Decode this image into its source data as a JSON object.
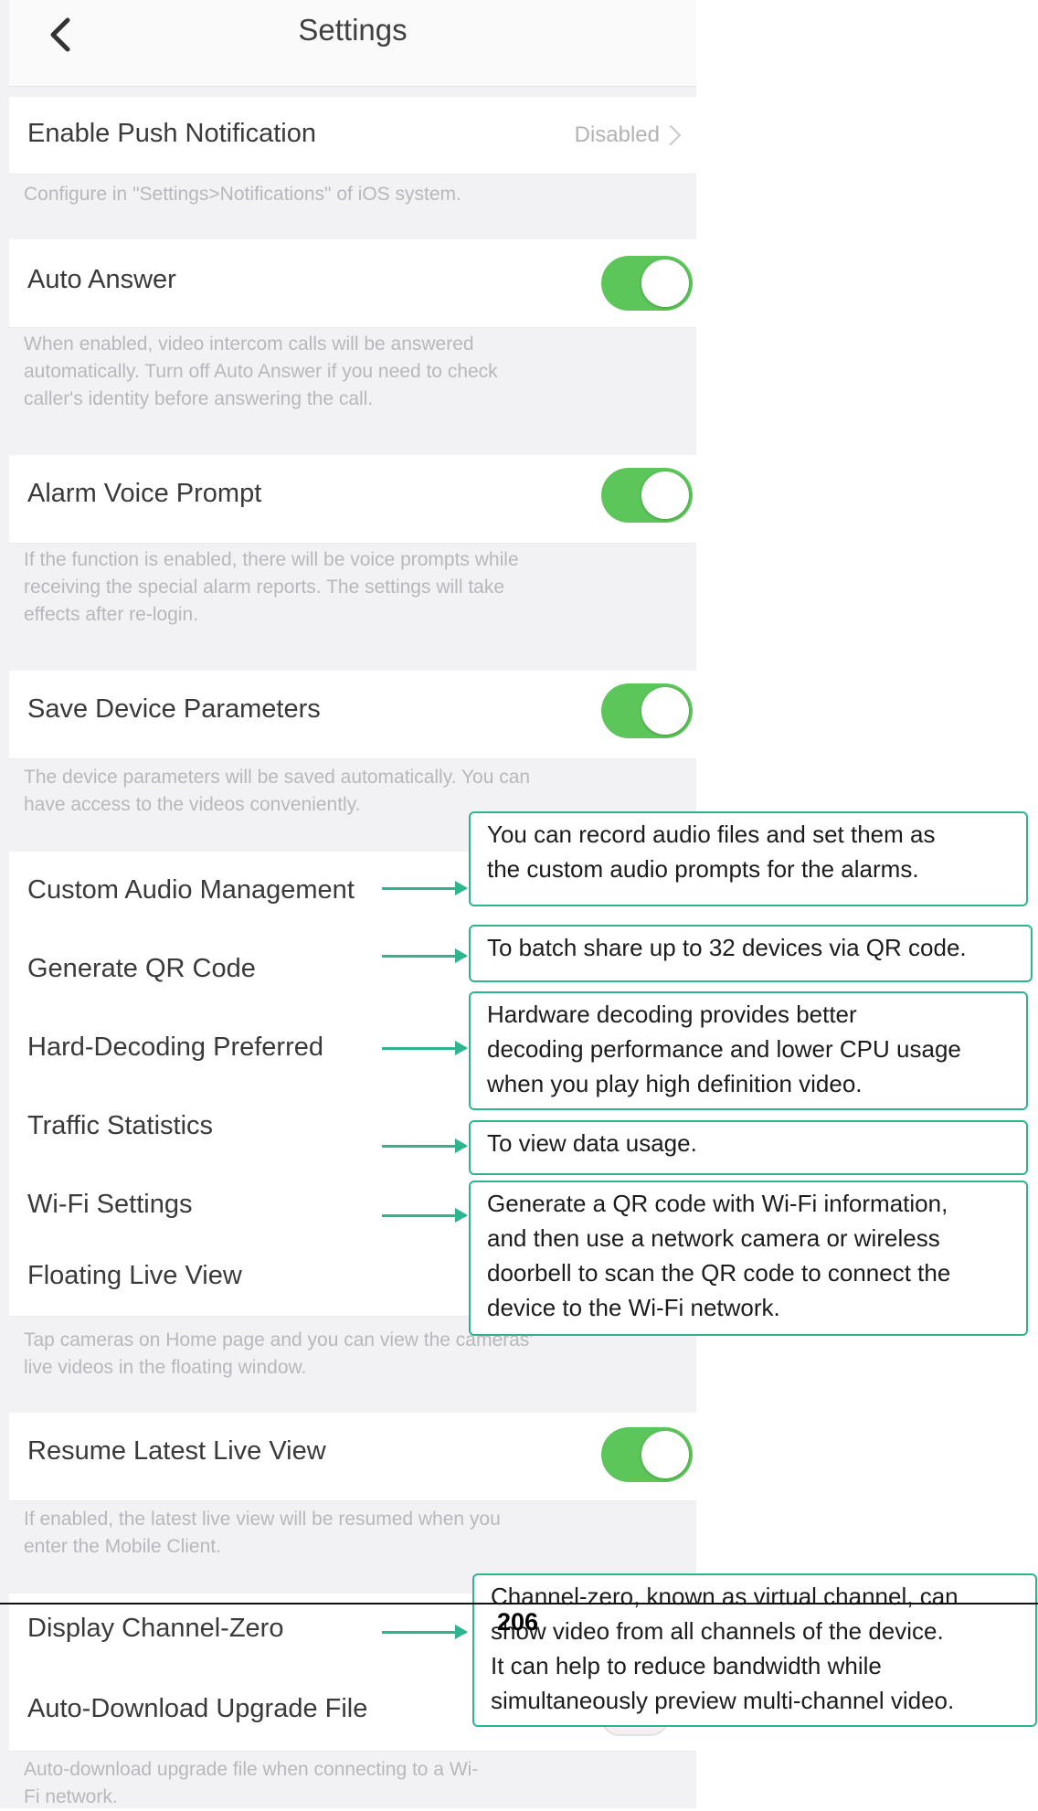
{
  "header": {
    "title": "Settings"
  },
  "push": {
    "label": "Enable Push Notification",
    "value": "Disabled"
  },
  "push_desc": "Configure in \"Settings>Notifications\" of iOS system.",
  "auto_answer": {
    "label": "Auto Answer",
    "desc": [
      "When enabled, video intercom calls will be answered",
      "automatically. Turn off Auto Answer if you need to check",
      "caller's identity before answering the call."
    ]
  },
  "alarm_voice": {
    "label": "Alarm Voice Prompt",
    "desc": [
      "If the function is enabled, there will be voice prompts while",
      "receiving the special alarm reports. The settings will take",
      "effects after re-login."
    ]
  },
  "save_params": {
    "label": "Save Device Parameters",
    "desc": [
      "The device parameters will be saved automatically. You can",
      "have access to the videos conveniently."
    ]
  },
  "custom_audio": {
    "label": "Custom Audio Management"
  },
  "qr_code": {
    "label": "Generate QR Code"
  },
  "hard_decoding": {
    "label": "Hard-Decoding Preferred"
  },
  "traffic": {
    "label": "Traffic Statistics"
  },
  "wifi": {
    "label": "Wi-Fi Settings"
  },
  "floating": {
    "label": "Floating Live View",
    "desc": [
      "Tap cameras on Home page and you can view the cameras'",
      "live videos in the floating window."
    ]
  },
  "resume": {
    "label": "Resume Latest Live View",
    "desc": [
      "If enabled, the latest live view will be resumed when you",
      "enter the Mobile Client."
    ]
  },
  "channel_zero": {
    "label": "Display Channel-Zero"
  },
  "auto_download": {
    "label": "Auto-Download Upgrade File",
    "desc": [
      "Auto-download upgrade file when connecting to a Wi-",
      "Fi network."
    ]
  },
  "callouts": {
    "custom_audio": [
      "You can record audio files and set them as",
      "the custom audio prompts for the alarms."
    ],
    "qr_code": [
      "To batch share up to 32 devices via QR code."
    ],
    "hard_decoding": [
      "Hardware decoding provides better",
      "decoding performance and lower CPU usage",
      "when you play high definition video."
    ],
    "traffic": [
      "To view data usage."
    ],
    "wifi": [
      "Generate a QR code with Wi-Fi information,",
      "and then use a network camera or wireless",
      "doorbell to scan the QR code to connect the",
      "device to the Wi-Fi network."
    ],
    "channel_zero": [
      "Channel-zero, known as virtual channel, can",
      "show video from all channels of the device.",
      "It can help to reduce bandwidth while",
      "simultaneously preview multi-channel video."
    ]
  },
  "page_number": "206",
  "colors": {
    "toggle_on": "#5cc65a",
    "callout_border": "#2eb58f",
    "background": "#f2f2f4"
  },
  "icons": {
    "back": "chevron-left-icon",
    "disclosure": "chevron-right-icon"
  }
}
